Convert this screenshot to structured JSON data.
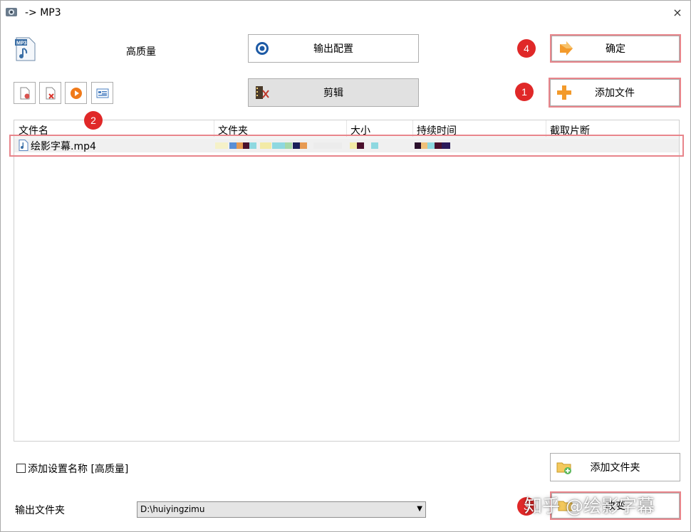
{
  "window": {
    "title": "-> MP3",
    "close_glyph": "×"
  },
  "profile": {
    "quality": "高质量",
    "format_icon_text": "MP3"
  },
  "buttons": {
    "output_config": "输出配置",
    "edit": "剪辑",
    "ok": "确定",
    "add_file": "添加文件",
    "add_folder": "添加文件夹",
    "change": "改变"
  },
  "badges": {
    "ok": "4",
    "add_file": "1",
    "row": "2",
    "change": "3"
  },
  "toolbar": [
    "remove-file-icon",
    "delete-icon",
    "play-icon",
    "info-icon"
  ],
  "table": {
    "columns": [
      "文件名",
      "文件夹",
      "大小",
      "持续时间",
      "截取片断"
    ],
    "rows": [
      {
        "name": "绘影字幕.mp4"
      }
    ]
  },
  "options": {
    "add_setting_name": "添加设置名称 [高质量]"
  },
  "output": {
    "label": "输出文件夹",
    "path": "D:\\huiyingzimu"
  },
  "watermark": "知乎 @绘影字幕",
  "colors": {
    "badge": "#e02828",
    "highlight": "#e8858b"
  }
}
